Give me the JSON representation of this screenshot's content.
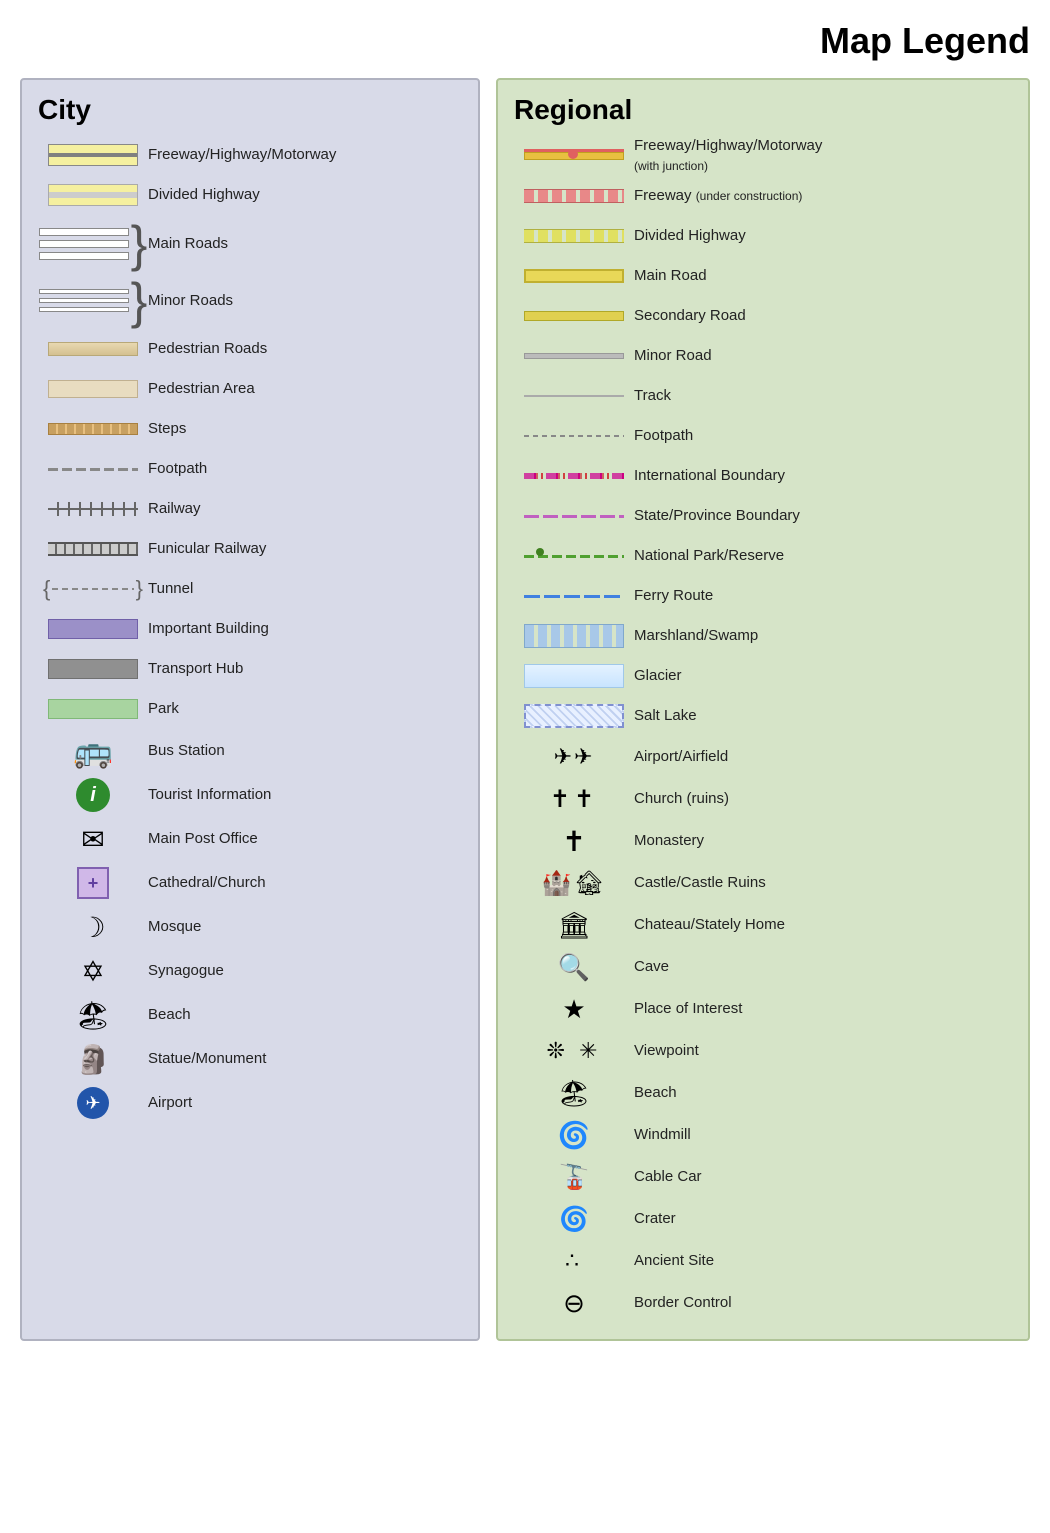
{
  "title": "Map Legend",
  "city": {
    "title": "City",
    "items": [
      {
        "label": "Freeway/Highway/Motorway",
        "type": "freeway"
      },
      {
        "label": "Divided Highway",
        "type": "divided"
      },
      {
        "label": "Main Roads",
        "type": "main-roads"
      },
      {
        "label": "Minor Roads",
        "type": "minor-roads"
      },
      {
        "label": "Pedestrian Roads",
        "type": "ped-roads"
      },
      {
        "label": "Pedestrian Area",
        "type": "ped-area"
      },
      {
        "label": "Steps",
        "type": "steps"
      },
      {
        "label": "Footpath",
        "type": "footpath"
      },
      {
        "label": "Railway",
        "type": "railway"
      },
      {
        "label": "Funicular Railway",
        "type": "funicular"
      },
      {
        "label": "Tunnel",
        "type": "tunnel"
      },
      {
        "label": "Important Building",
        "type": "imp-building"
      },
      {
        "label": "Transport Hub",
        "type": "transport-hub"
      },
      {
        "label": "Park",
        "type": "park"
      },
      {
        "label": "Bus Station",
        "type": "bus-station",
        "icon": "🚌"
      },
      {
        "label": "Tourist Information",
        "type": "tourist-info"
      },
      {
        "label": "Main Post Office",
        "type": "post-office"
      },
      {
        "label": "Cathedral/Church",
        "type": "cathedral"
      },
      {
        "label": "Mosque",
        "type": "mosque"
      },
      {
        "label": "Synagogue",
        "type": "synagogue"
      },
      {
        "label": "Beach",
        "type": "beach"
      },
      {
        "label": "Statue/Monument",
        "type": "monument"
      },
      {
        "label": "Airport",
        "type": "airport"
      }
    ]
  },
  "regional": {
    "title": "Regional",
    "items": [
      {
        "label": "Freeway/Highway/Motorway\n(with junction)",
        "type": "reg-freeway-j"
      },
      {
        "label": "Freeway (under construction)",
        "type": "reg-freeway-uc"
      },
      {
        "label": "Divided Highway",
        "type": "reg-divided"
      },
      {
        "label": "Main Road",
        "type": "reg-main"
      },
      {
        "label": "Secondary Road",
        "type": "reg-secondary"
      },
      {
        "label": "Minor Road",
        "type": "reg-minor"
      },
      {
        "label": "Track",
        "type": "reg-track"
      },
      {
        "label": "Footpath",
        "type": "reg-footpath"
      },
      {
        "label": "International Boundary",
        "type": "reg-intl"
      },
      {
        "label": "State/Province Boundary",
        "type": "reg-state"
      },
      {
        "label": "National Park/Reserve",
        "type": "reg-natpark"
      },
      {
        "label": "Ferry Route",
        "type": "reg-ferry"
      },
      {
        "label": "Marshland/Swamp",
        "type": "reg-marsh"
      },
      {
        "label": "Glacier",
        "type": "reg-glacier"
      },
      {
        "label": "Salt Lake",
        "type": "reg-salt"
      },
      {
        "label": "Airport/Airfield",
        "type": "reg-airport"
      },
      {
        "label": "Church (ruins)",
        "type": "reg-church"
      },
      {
        "label": "Monastery",
        "type": "reg-monastery"
      },
      {
        "label": "Castle/Castle Ruins",
        "type": "reg-castle"
      },
      {
        "label": "Chateau/Stately Home",
        "type": "reg-chateau"
      },
      {
        "label": "Cave",
        "type": "reg-cave"
      },
      {
        "label": "Place of Interest",
        "type": "reg-poi"
      },
      {
        "label": "Viewpoint",
        "type": "reg-viewpoint"
      },
      {
        "label": "Beach",
        "type": "reg-beach"
      },
      {
        "label": "Windmill",
        "type": "reg-windmill"
      },
      {
        "label": "Cable Car",
        "type": "reg-cablecar"
      },
      {
        "label": "Crater",
        "type": "reg-crater"
      },
      {
        "label": "Ancient Site",
        "type": "reg-ancient"
      },
      {
        "label": "Border Control",
        "type": "reg-border"
      }
    ]
  }
}
